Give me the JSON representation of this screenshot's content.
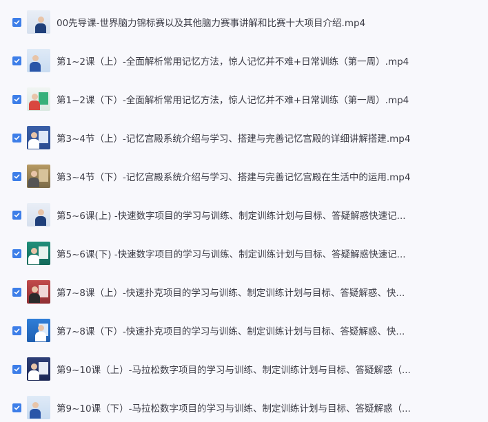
{
  "files": [
    {
      "name": "00先导课-世界脑力锦标赛以及其他脑力赛事讲解和比赛十大项目介绍.mp4",
      "checked": true,
      "thumb_style": "a"
    },
    {
      "name": "第1~2课（上）-全面解析常用记忆方法，惊人记忆并不难+日常训练（第一周）.mp4",
      "checked": true,
      "thumb_style": "b"
    },
    {
      "name": "第1~2课（下）-全面解析常用记忆方法，惊人记忆并不难+日常训练（第一周）.mp4",
      "checked": true,
      "thumb_style": "c"
    },
    {
      "name": "第3~4节（上）-记忆宫殿系统介绍与学习、搭建与完善记忆宫殿的详细讲解搭建.mp4",
      "checked": true,
      "thumb_style": "d"
    },
    {
      "name": "第3~4节（下）-记忆宫殿系统介绍与学习、搭建与完善记忆宫殿在生活中的运用.mp4",
      "checked": true,
      "thumb_style": "e"
    },
    {
      "name": "第5~6课(上) -快速数字项目的学习与训练、制定训练计划与目标、答疑解惑快速记...",
      "checked": true,
      "thumb_style": "a"
    },
    {
      "name": "第5~6课(下) -快速数字项目的学习与训练、制定训练计划与目标、答疑解惑快速记...",
      "checked": true,
      "thumb_style": "f"
    },
    {
      "name": "第7~8课（上）-快速扑克项目的学习与训练、制定训练计划与目标、答疑解惑、快...",
      "checked": true,
      "thumb_style": "g"
    },
    {
      "name": "第7~8课（下）-快速扑克项目的学习与训练、制定训练计划与目标、答疑解惑、快...",
      "checked": true,
      "thumb_style": "h"
    },
    {
      "name": "第9~10课（上）-马拉松数字项目的学习与训练、制定训练计划与目标、答疑解惑（...",
      "checked": true,
      "thumb_style": "i"
    },
    {
      "name": "第9~10课（下）-马拉松数字项目的学习与训练、制定训练计划与目标、答疑解惑（...",
      "checked": true,
      "thumb_style": "b"
    }
  ],
  "colors": {
    "checkbox": "#3d7ee8",
    "text": "#3c3c46",
    "background": "#f8f8fc"
  }
}
